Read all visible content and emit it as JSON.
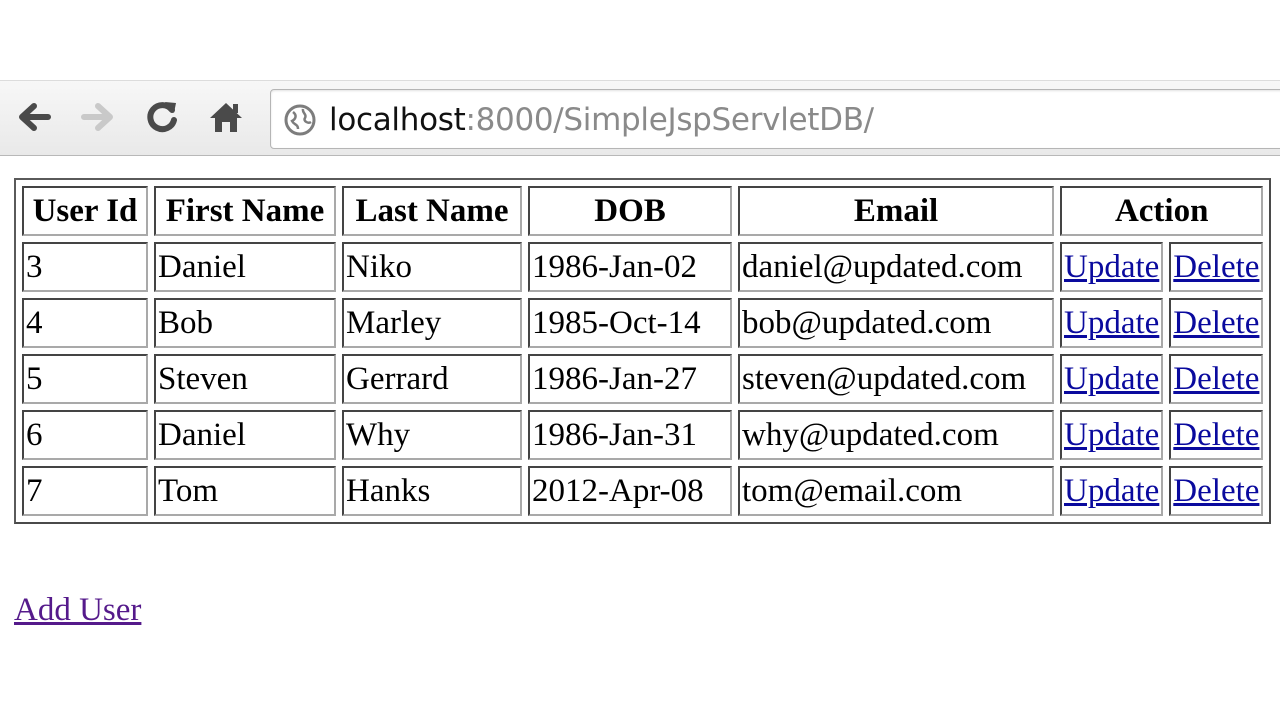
{
  "browser": {
    "url_host": "localhost",
    "url_path": ":8000/SimpleJspServletDB/",
    "icons": [
      "back-arrow-icon",
      "forward-arrow-icon",
      "reload-icon",
      "home-icon",
      "globe-icon"
    ]
  },
  "table": {
    "headers": [
      "User Id",
      "First Name",
      "Last Name",
      "DOB",
      "Email",
      "Action"
    ],
    "rows": [
      {
        "id": "3",
        "first": "Daniel",
        "last": "Niko",
        "dob": "1986-Jan-02",
        "email": "daniel@updated.com",
        "update": "Update",
        "delete": "Delete"
      },
      {
        "id": "4",
        "first": "Bob",
        "last": "Marley",
        "dob": "1985-Oct-14",
        "email": "bob@updated.com",
        "update": "Update",
        "delete": "Delete"
      },
      {
        "id": "5",
        "first": "Steven",
        "last": "Gerrard",
        "dob": "1986-Jan-27",
        "email": "steven@updated.com",
        "update": "Update",
        "delete": "Delete"
      },
      {
        "id": "6",
        "first": "Daniel",
        "last": "Why",
        "dob": "1986-Jan-31",
        "email": "why@updated.com",
        "update": "Update",
        "delete": "Delete"
      },
      {
        "id": "7",
        "first": "Tom",
        "last": "Hanks",
        "dob": "2012-Apr-08",
        "email": "tom@email.com",
        "update": "Update",
        "delete": "Delete"
      }
    ]
  },
  "add_user_label": "Add User",
  "colors": {
    "link": "#0a0a9e",
    "visited_link": "#551a8b",
    "url_path": "#8a8a8a"
  }
}
